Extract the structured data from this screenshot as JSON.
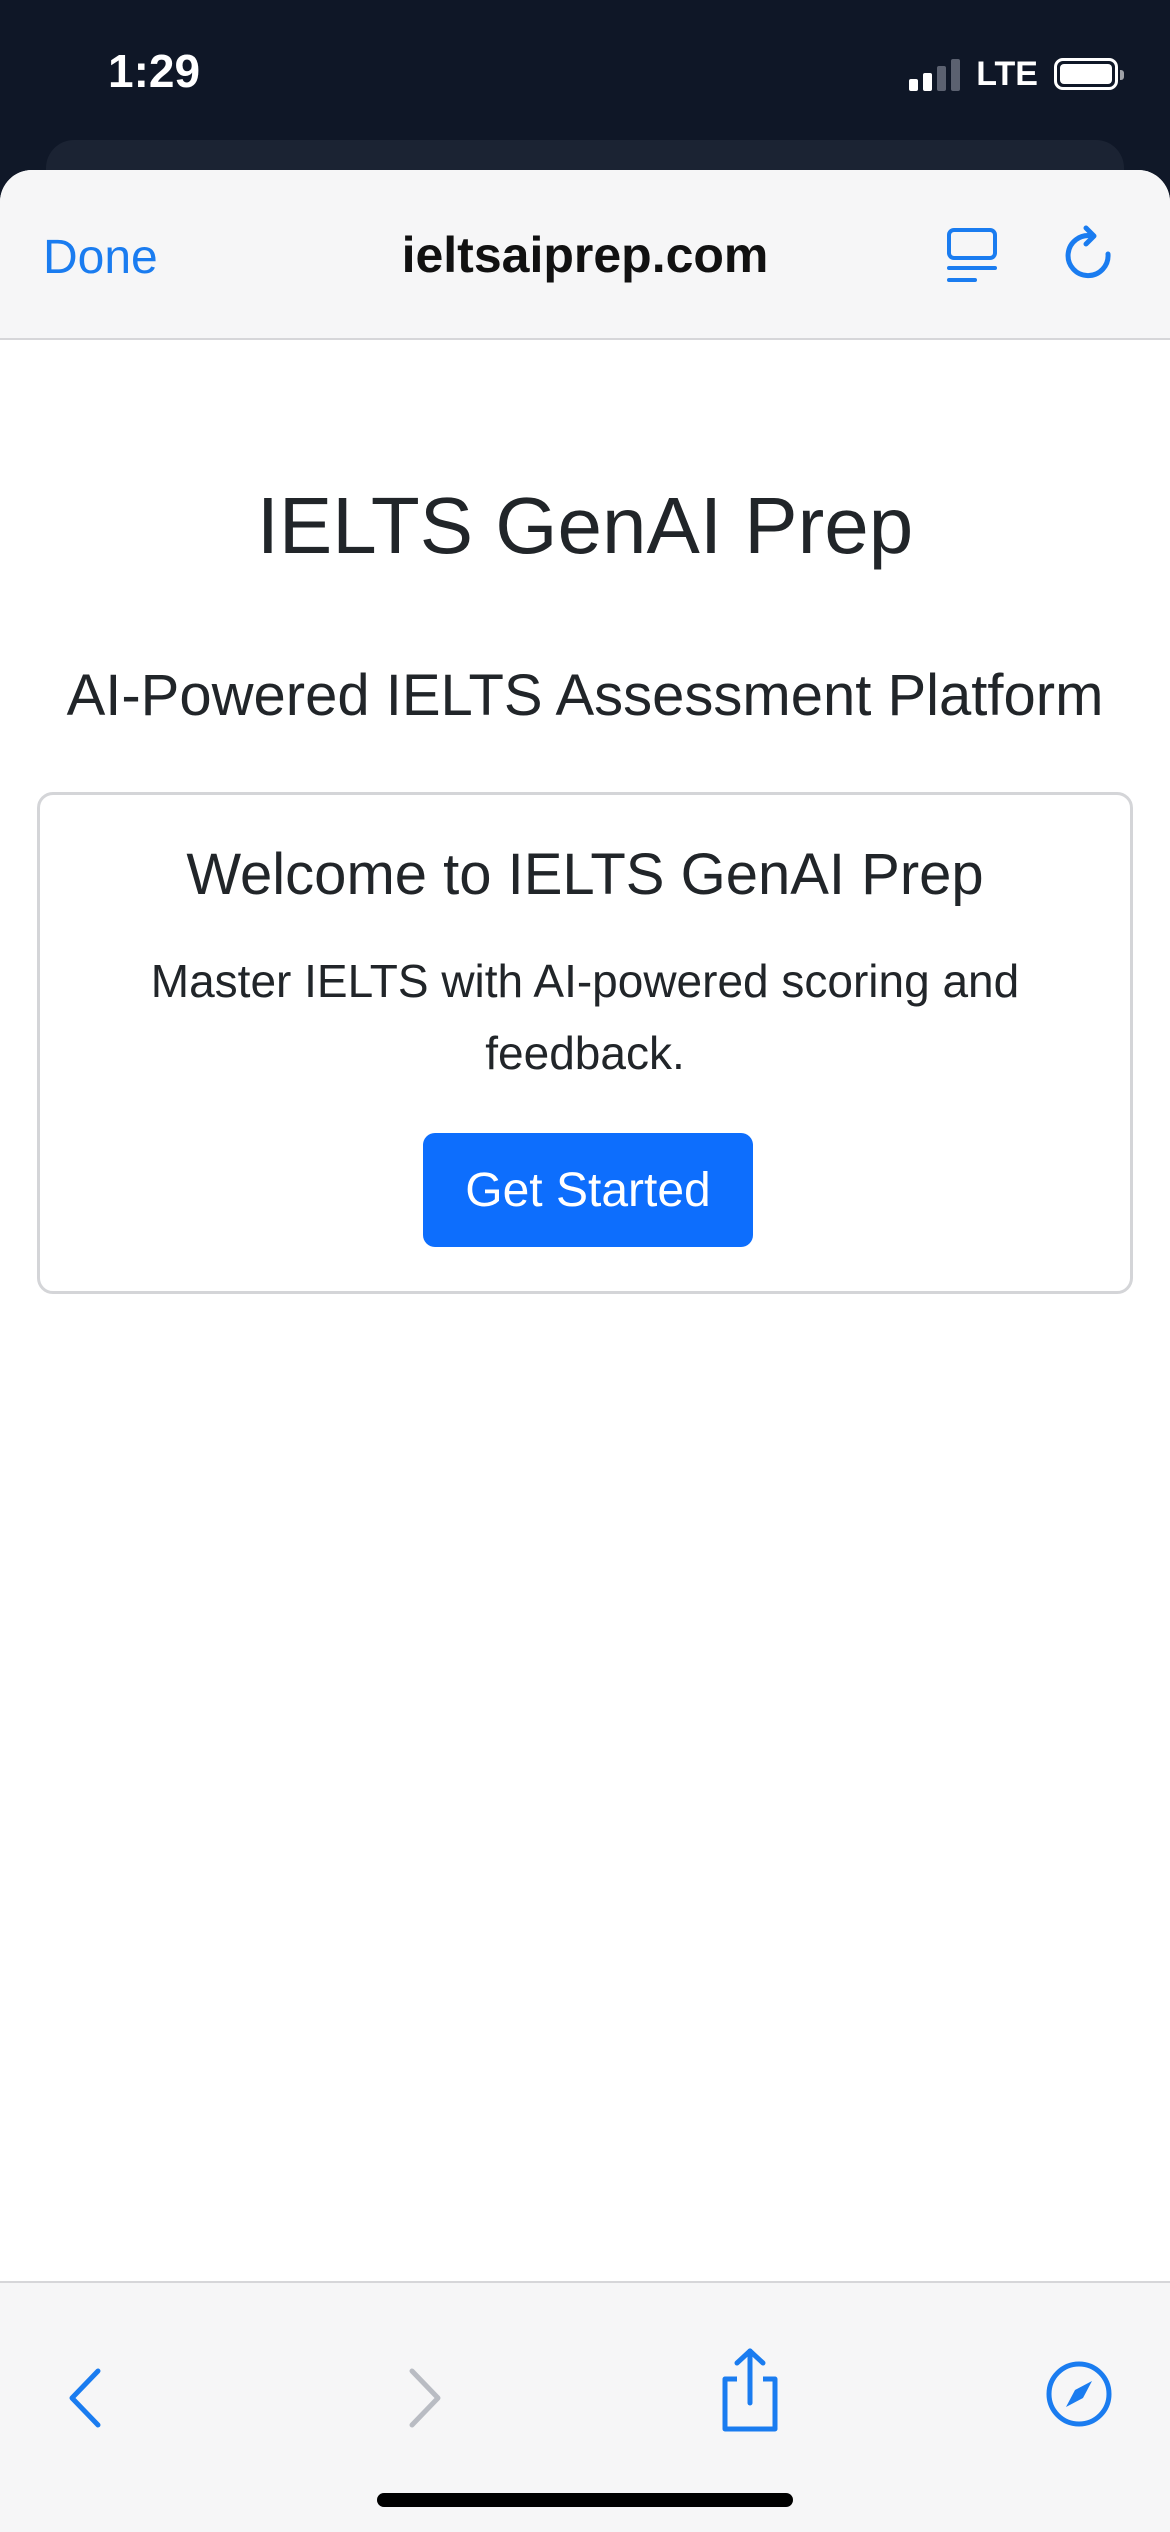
{
  "status_bar": {
    "time": "1:29",
    "network": "LTE"
  },
  "browser": {
    "done_label": "Done",
    "url": "ieltsaiprep.com",
    "icons": {
      "reader": "reader-mode-icon",
      "reload": "reload-icon",
      "back": "chevron-left-icon",
      "forward": "chevron-right-icon",
      "share": "share-icon",
      "compass": "compass-icon"
    },
    "accent_color": "#1a7cf0"
  },
  "page": {
    "title": "IELTS GenAI Prep",
    "subtitle": "AI-Powered IELTS Assessment Platform",
    "card": {
      "title": "Welcome to IELTS GenAI Prep",
      "text": "Master IELTS with AI-powered scoring and feedback.",
      "button_label": "Get Started",
      "button_color": "#0d6efd"
    }
  }
}
